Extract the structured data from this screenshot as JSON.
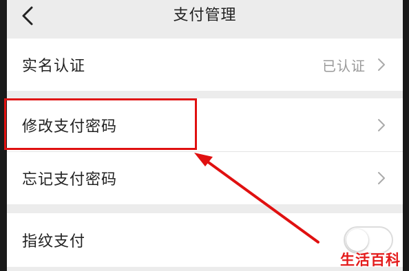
{
  "header": {
    "title": "支付管理",
    "back_icon": "chevron-left-icon"
  },
  "settings": [
    {
      "label": "实名认证",
      "value": "已认证",
      "has_chevron": true
    },
    {
      "label": "修改支付密码",
      "value": "",
      "has_chevron": true
    },
    {
      "label": "忘记支付密码",
      "value": "",
      "has_chevron": true
    },
    {
      "label": "指纹支付",
      "toggle_on": false
    }
  ],
  "annotation": {
    "highlight_color": "#e01010",
    "arrow_color": "#e01010"
  },
  "watermark": "生活百科"
}
